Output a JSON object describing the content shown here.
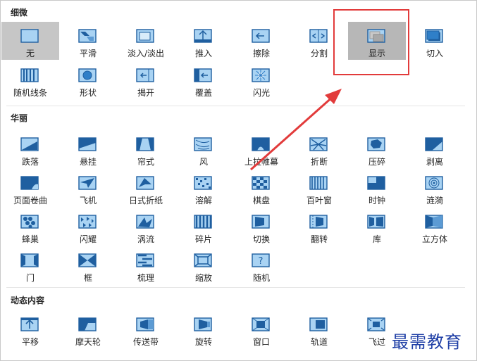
{
  "sections": {
    "subtle": "细微",
    "exciting": "华丽",
    "dynamic": "动态内容"
  },
  "tiles": [
    {
      "label": "无",
      "icon": "none-icon",
      "row": 0,
      "col": 0,
      "state": "selected"
    },
    {
      "label": "平滑",
      "icon": "smooth-icon",
      "row": 0,
      "col": 1
    },
    {
      "label": "淡入/淡出",
      "icon": "fade-icon",
      "row": 0,
      "col": 2
    },
    {
      "label": "推入",
      "icon": "push-icon",
      "row": 0,
      "col": 3
    },
    {
      "label": "擦除",
      "icon": "wipe-icon",
      "row": 0,
      "col": 4
    },
    {
      "label": "分割",
      "icon": "split-icon",
      "row": 0,
      "col": 5
    },
    {
      "label": "显示",
      "icon": "reveal-icon",
      "row": 0,
      "col": 6,
      "state": "highlight"
    },
    {
      "label": "切入",
      "icon": "cut-icon",
      "row": 0,
      "col": 7
    },
    {
      "label": "随机线条",
      "icon": "random-bars-icon",
      "row": 1,
      "col": 0
    },
    {
      "label": "形状",
      "icon": "shape-icon",
      "row": 1,
      "col": 1
    },
    {
      "label": "揭开",
      "icon": "uncover-icon",
      "row": 1,
      "col": 2
    },
    {
      "label": "覆盖",
      "icon": "cover-icon",
      "row": 1,
      "col": 3
    },
    {
      "label": "闪光",
      "icon": "flash-icon",
      "row": 1,
      "col": 4
    },
    {
      "label": "跌落",
      "icon": "fall-over-icon",
      "row": 2,
      "col": 0
    },
    {
      "label": "悬挂",
      "icon": "drape-icon",
      "row": 2,
      "col": 1
    },
    {
      "label": "帘式",
      "icon": "curtains-icon",
      "row": 2,
      "col": 2
    },
    {
      "label": "风",
      "icon": "wind-icon",
      "row": 2,
      "col": 3
    },
    {
      "label": "上拉帷幕",
      "icon": "prestige-icon",
      "row": 2,
      "col": 4
    },
    {
      "label": "折断",
      "icon": "fracture-icon",
      "row": 2,
      "col": 5
    },
    {
      "label": "压碎",
      "icon": "crush-icon",
      "row": 2,
      "col": 6
    },
    {
      "label": "剥离",
      "icon": "peel-off-icon",
      "row": 2,
      "col": 7
    },
    {
      "label": "页面卷曲",
      "icon": "page-curl-icon",
      "row": 3,
      "col": 0
    },
    {
      "label": "飞机",
      "icon": "airplane-icon",
      "row": 3,
      "col": 1
    },
    {
      "label": "日式折纸",
      "icon": "origami-icon",
      "row": 3,
      "col": 2
    },
    {
      "label": "溶解",
      "icon": "dissolve-icon",
      "row": 3,
      "col": 3
    },
    {
      "label": "棋盘",
      "icon": "checkerboard-icon",
      "row": 3,
      "col": 4
    },
    {
      "label": "百叶窗",
      "icon": "blinds-icon",
      "row": 3,
      "col": 5
    },
    {
      "label": "时钟",
      "icon": "clock-icon",
      "row": 3,
      "col": 6
    },
    {
      "label": "涟漪",
      "icon": "ripple-icon",
      "row": 3,
      "col": 7
    },
    {
      "label": "蜂巢",
      "icon": "honeycomb-icon",
      "row": 4,
      "col": 0
    },
    {
      "label": "闪耀",
      "icon": "glitter-icon",
      "row": 4,
      "col": 1
    },
    {
      "label": "涡流",
      "icon": "vortex-icon",
      "row": 4,
      "col": 2
    },
    {
      "label": "碎片",
      "icon": "shred-icon",
      "row": 4,
      "col": 3
    },
    {
      "label": "切换",
      "icon": "switch-icon",
      "row": 4,
      "col": 4
    },
    {
      "label": "翻转",
      "icon": "flip-icon",
      "row": 4,
      "col": 5
    },
    {
      "label": "库",
      "icon": "gallery-icon",
      "row": 4,
      "col": 6
    },
    {
      "label": "立方体",
      "icon": "cube-icon",
      "row": 4,
      "col": 7
    },
    {
      "label": "门",
      "icon": "doors-icon",
      "row": 5,
      "col": 0
    },
    {
      "label": "框",
      "icon": "box-icon",
      "row": 5,
      "col": 1
    },
    {
      "label": "梳理",
      "icon": "comb-icon",
      "row": 5,
      "col": 2
    },
    {
      "label": "缩放",
      "icon": "zoom-icon",
      "row": 5,
      "col": 3
    },
    {
      "label": "随机",
      "icon": "random-icon",
      "row": 5,
      "col": 4
    },
    {
      "label": "平移",
      "icon": "pan-icon",
      "row": 6,
      "col": 0
    },
    {
      "label": "摩天轮",
      "icon": "ferris-wheel-icon",
      "row": 6,
      "col": 1
    },
    {
      "label": "传送带",
      "icon": "conveyor-icon",
      "row": 6,
      "col": 2
    },
    {
      "label": "旋转",
      "icon": "rotate-icon",
      "row": 6,
      "col": 3
    },
    {
      "label": "窗口",
      "icon": "window-icon",
      "row": 6,
      "col": 4
    },
    {
      "label": "轨道",
      "icon": "orbit-icon",
      "row": 6,
      "col": 5
    },
    {
      "label": "飞过",
      "icon": "fly-through-icon",
      "row": 6,
      "col": 6
    }
  ],
  "watermark": "最需教育",
  "colors": {
    "icon_dark": "#1f5fa0",
    "icon_light": "#a9d3f3",
    "annotation_red": "#e23b3b",
    "watermark": "#1f3fa6"
  }
}
